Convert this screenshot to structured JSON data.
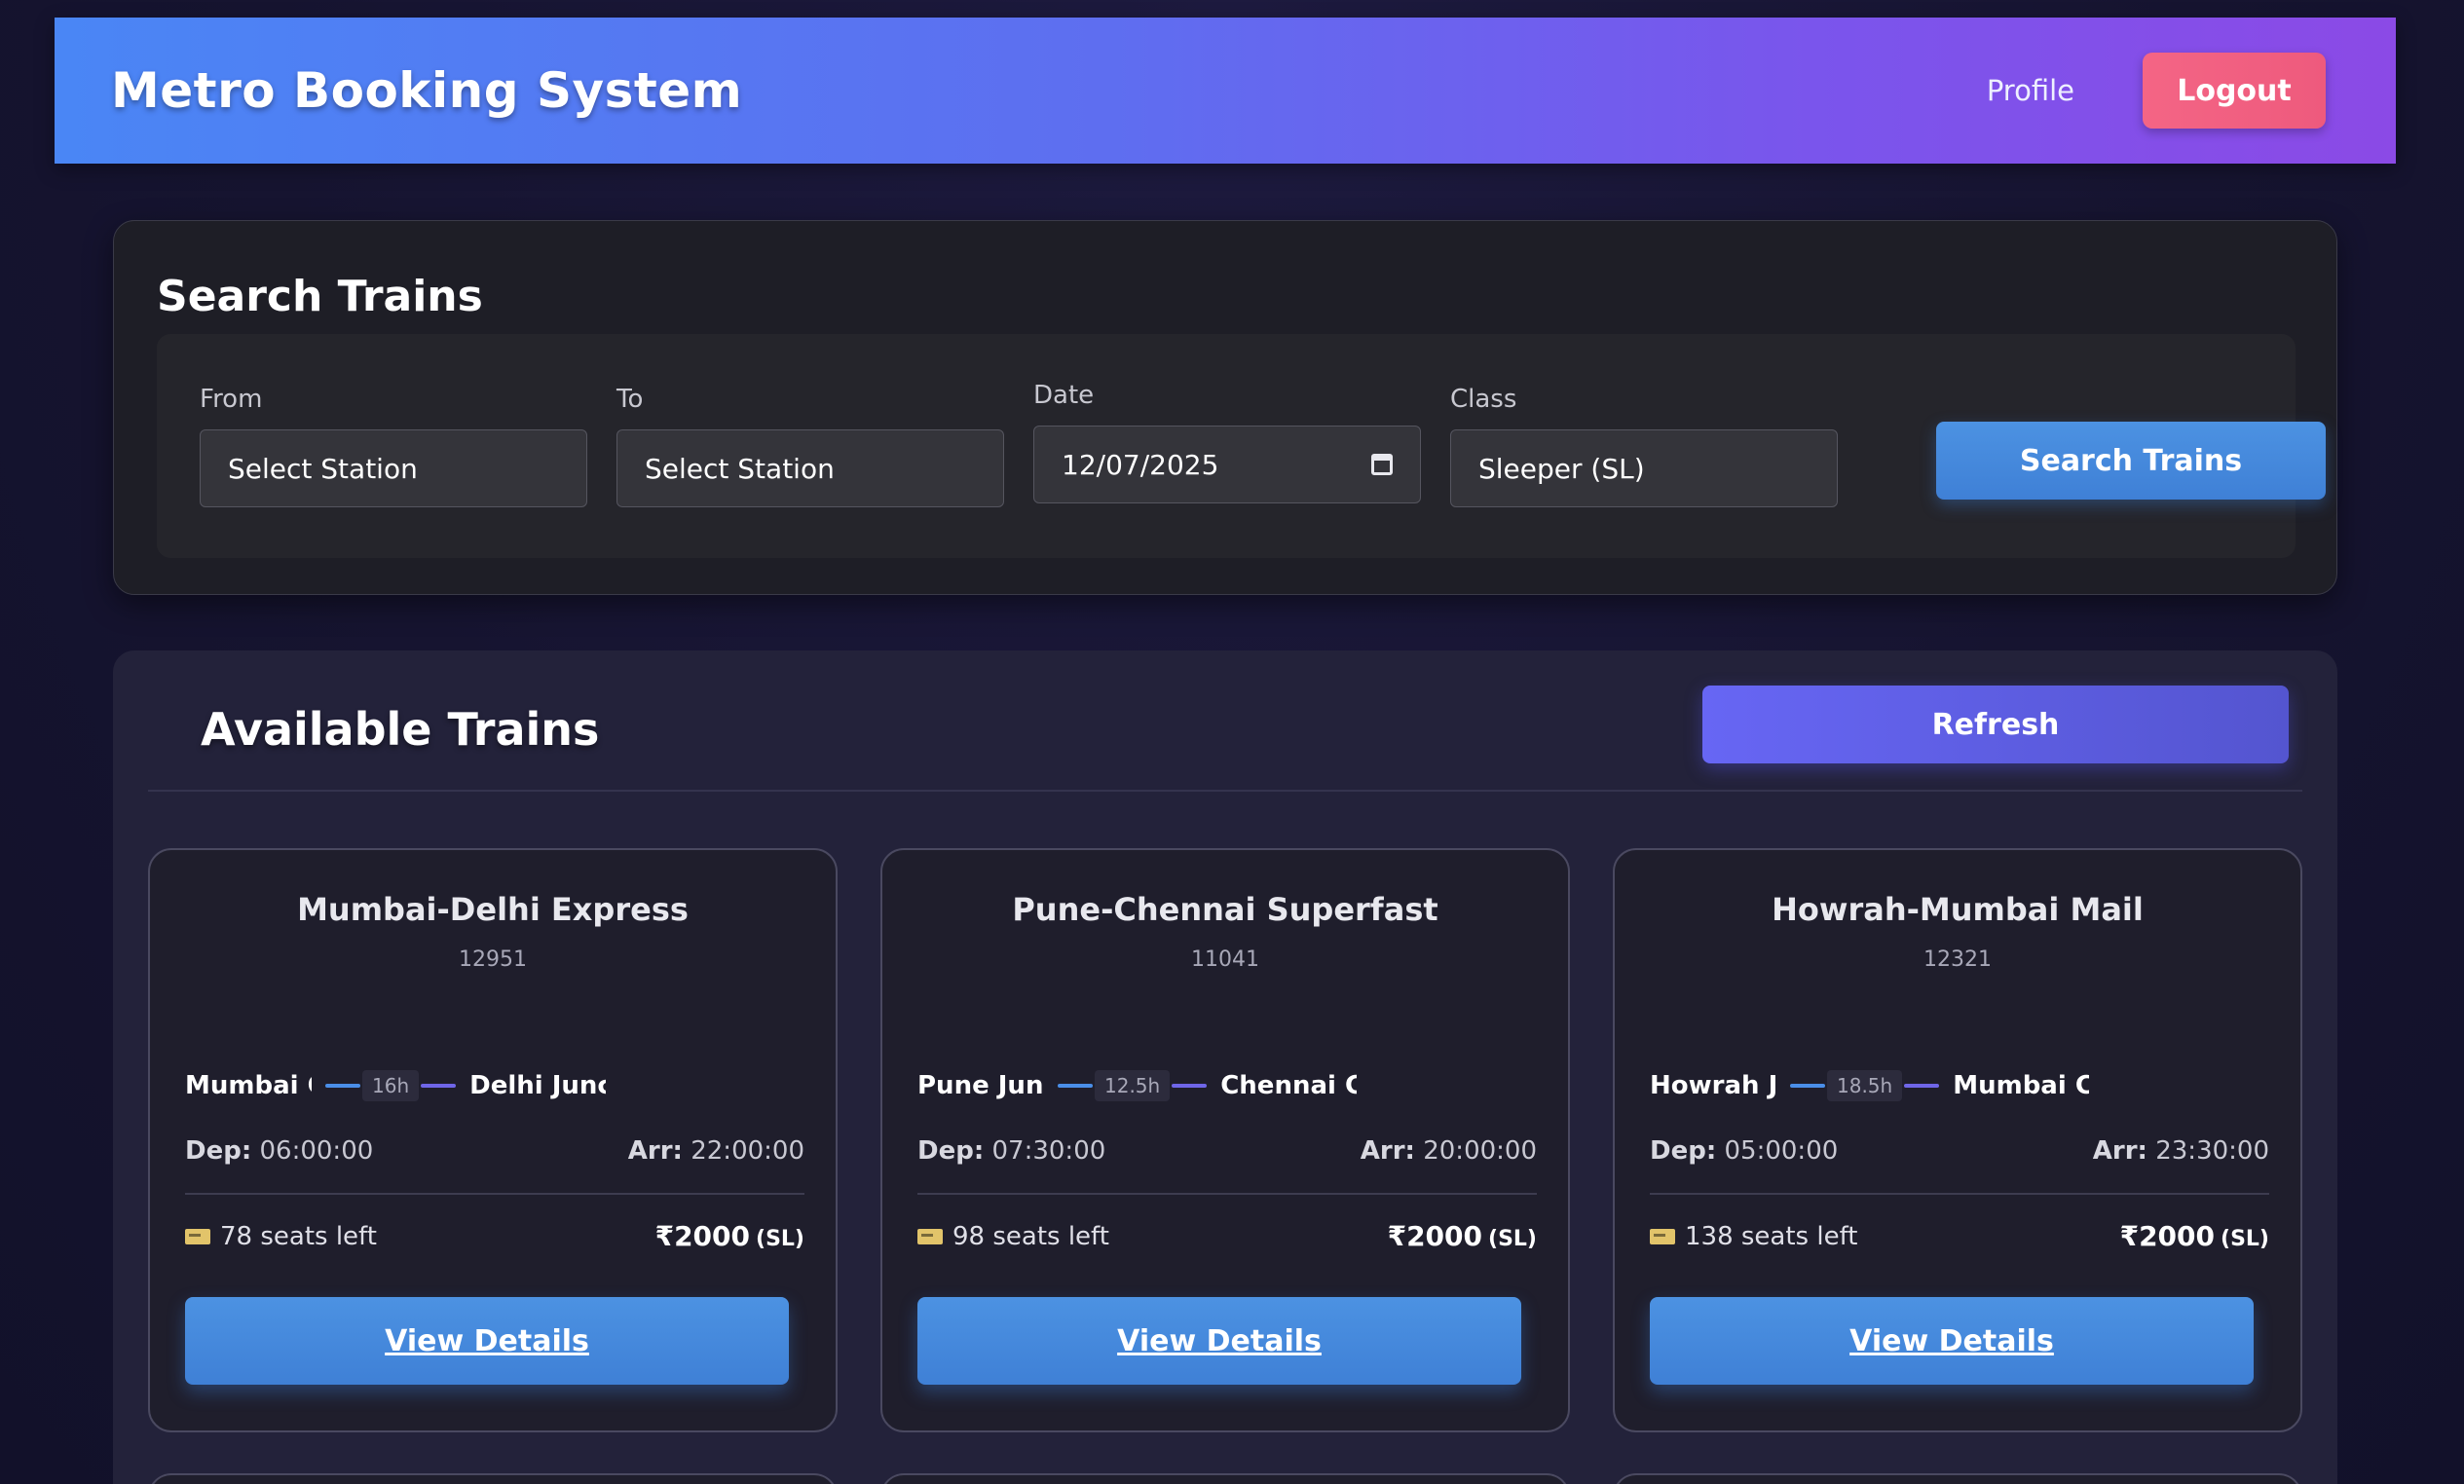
{
  "header": {
    "title": "Metro Booking System",
    "profile_label": "Profile",
    "logout_label": "Logout"
  },
  "search": {
    "title": "Search Trains",
    "from": {
      "label": "From",
      "value": "Select Station"
    },
    "to": {
      "label": "To",
      "value": "Select Station"
    },
    "date": {
      "label": "Date",
      "value": "12/07/2025"
    },
    "class": {
      "label": "Class",
      "value": "Sleeper (SL)"
    },
    "button_label": "Search Trains"
  },
  "results": {
    "title": "Available Trains",
    "refresh_label": "Refresh",
    "dep_label": "Dep:",
    "arr_label": "Arr:",
    "details_label": "View Details",
    "trains": [
      {
        "name": "Mumbai-Delhi Express",
        "number": "12951",
        "from": "Mumbai C",
        "to": "Delhi Junc",
        "duration": "16h",
        "departure": "06:00:00",
        "arrival": "22:00:00",
        "seats": "78 seats left",
        "price": "₹2000",
        "class": "(SL)"
      },
      {
        "name": "Pune-Chennai Superfast",
        "number": "11041",
        "from": "Pune Junc",
        "to": "Chennai C",
        "duration": "12.5h",
        "departure": "07:30:00",
        "arrival": "20:00:00",
        "seats": "98 seats left",
        "price": "₹2000",
        "class": "(SL)"
      },
      {
        "name": "Howrah-Mumbai Mail",
        "number": "12321",
        "from": "Howrah Ju",
        "to": "Mumbai Ce",
        "duration": "18.5h",
        "departure": "05:00:00",
        "arrival": "23:30:00",
        "seats": "138 seats left",
        "price": "₹2000",
        "class": "(SL)"
      }
    ]
  },
  "colors": {
    "header_gradient_start": "#4a86f5",
    "header_gradient_end": "#8b4ae6",
    "logout": "#f46585",
    "primary_button": "#4c92e2",
    "refresh_button": "#6766f4"
  },
  "icons": {
    "date_picker": "calendar-icon",
    "seats": "ticket-icon"
  }
}
